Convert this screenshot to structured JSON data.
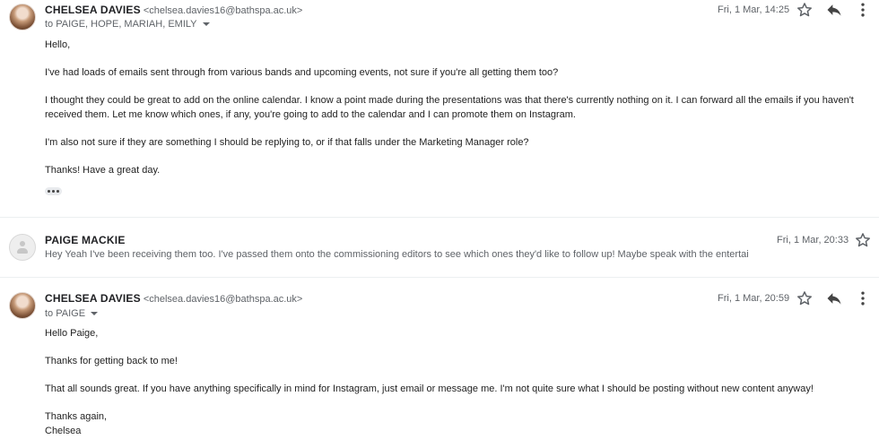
{
  "messages": [
    {
      "sender": "CHELSEA DAVIES",
      "email": "<chelsea.davies16@bathspa.ac.uk>",
      "to": "to PAIGE, HOPE, MARIAH, EMILY",
      "date": "Fri, 1 Mar, 14:25",
      "body": [
        "Hello,",
        "I've had loads of emails sent through from various bands and upcoming events, not sure if you're all getting them too?",
        "I thought they could be great to add on the online calendar. I know a point made during the presentations was that there's currently nothing on it. I can forward all the emails if you haven't received them. Let me know which ones, if any, you're going to add to the calendar and I can promote them on Instagram.",
        "I'm also not sure if they are something I should be replying to, or if that falls under the Marketing Manager role?",
        "Thanks! Have a great day."
      ]
    },
    {
      "sender": "PAIGE MACKIE",
      "date": "Fri, 1 Mar, 20:33",
      "snippet": "Hey Yeah I've been receiving them too. I've passed them onto the commissioning editors to see which ones they'd like to follow up! Maybe speak with the entertai"
    },
    {
      "sender": "CHELSEA DAVIES",
      "email": "<chelsea.davies16@bathspa.ac.uk>",
      "to": "to PAIGE",
      "date": "Fri, 1 Mar, 20:59",
      "body": [
        "Hello Paige,",
        "Thanks for getting back to me!",
        "That all sounds great. If you have anything specifically in mind for Instagram, just email or message me. I'm not quite sure what I should be posting without new content anyway!",
        "Thanks again,",
        "Chelsea"
      ]
    }
  ],
  "icons": {
    "star": "star-icon",
    "reply": "reply-icon",
    "more": "more-vertical-icon",
    "avatar": "person-icon"
  }
}
